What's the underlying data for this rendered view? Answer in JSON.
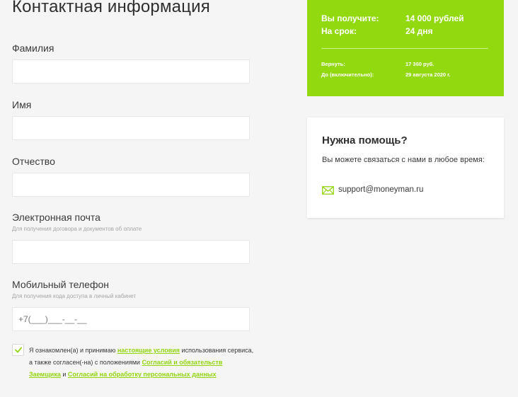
{
  "page_title": "Контактная информация",
  "fields": {
    "last_name": {
      "label": "Фамилия",
      "value": ""
    },
    "first_name": {
      "label": "Имя",
      "value": ""
    },
    "middle_name": {
      "label": "Отчество",
      "value": ""
    },
    "email": {
      "label": "Электронная почта",
      "hint": "Для получения договора и документов об оплате",
      "value": ""
    },
    "phone": {
      "label": "Мобильный телефон",
      "hint": "Для получения кода доступа в личный кабинет",
      "placeholder": "+7(___)___-__-__"
    }
  },
  "consent": {
    "checked": true,
    "text_before": "Я ознакомлен(а) и принимаю ",
    "link1": "настоящие условия",
    "text_mid1": " использования сервиса, а также согласен(-на) с положениями ",
    "link2": "Согласий и обязательств Заемщика",
    "text_mid2": " и ",
    "link3": "Согласий на обработку персональных данных"
  },
  "summary": {
    "receive_label": "Вы получите:",
    "receive_value": "14 000 рублей",
    "term_label": "На срок:",
    "term_value": "24 дня",
    "return_label": "Вернуть:",
    "return_value": "17 360 руб.",
    "until_label": "До (включительно):",
    "until_value": "29 августа 2020 г."
  },
  "help": {
    "title": "Нужна помощь?",
    "text": "Вы можете связаться с нами в любое время:",
    "email": "support@moneyman.ru",
    "email_icon": "envelope-icon"
  },
  "colors": {
    "accent": "#93d90f",
    "link": "#93d50f"
  }
}
